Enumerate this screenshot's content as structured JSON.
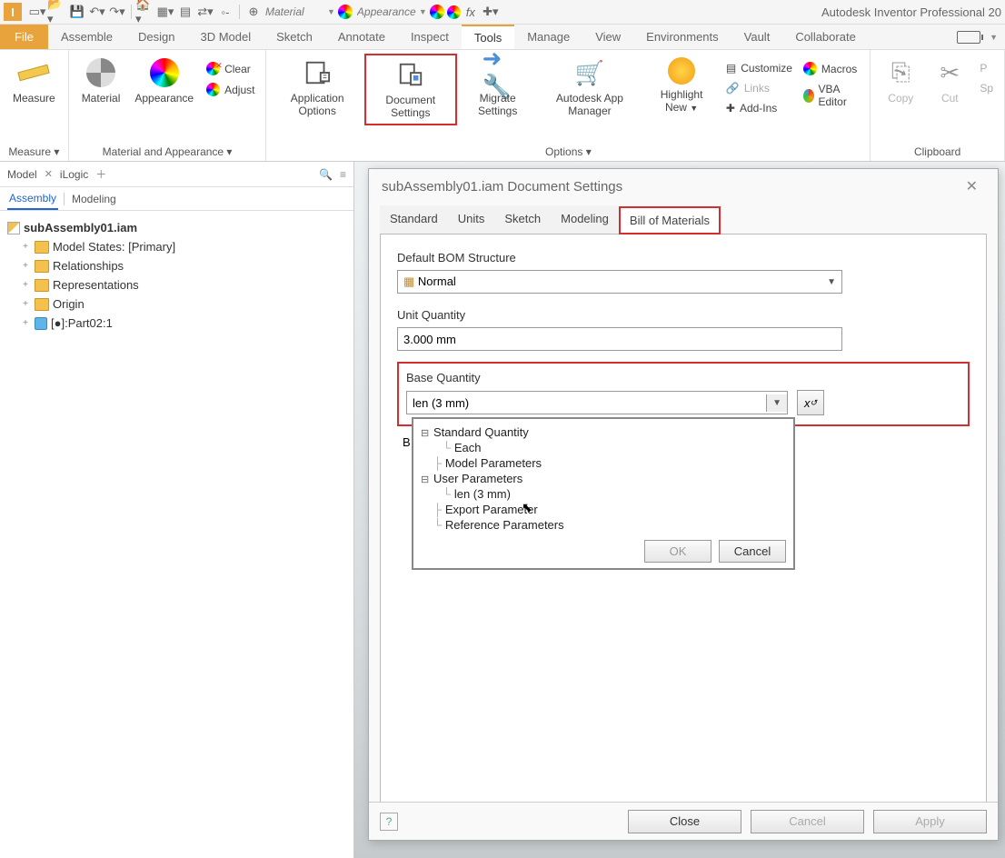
{
  "app_title": "Autodesk Inventor Professional 20",
  "material_placeholder": "Material",
  "appearance_placeholder": "Appearance",
  "menus": {
    "file": "File",
    "items": [
      "Assemble",
      "Design",
      "3D Model",
      "Sketch",
      "Annotate",
      "Inspect",
      "Tools",
      "Manage",
      "View",
      "Environments",
      "Vault",
      "Collaborate"
    ],
    "active": "Tools"
  },
  "ribbon": {
    "measure": {
      "label": "Measure",
      "group": "Measure ▾"
    },
    "material": {
      "label": "Material"
    },
    "appearance": {
      "label": "Appearance"
    },
    "clear": "Clear",
    "adjust": "Adjust",
    "matgroup": "Material and Appearance ▾",
    "appopts": "Application Options",
    "docsettings": "Document Settings",
    "migrate": "Migrate Settings",
    "appstore": "Autodesk App Manager",
    "highlight": "Highlight New",
    "customize": "Customize",
    "links": "Links",
    "addins": "Add-Ins",
    "macros": "Macros",
    "vba": "VBA Editor",
    "optgroup": "Options ▾",
    "copy": "Copy",
    "cut": "Cut",
    "paste": "P",
    "paste2": "Sp",
    "clipgroup": "Clipboard"
  },
  "panel": {
    "tab_model": "Model",
    "tab_ilogic": "iLogic",
    "sub_assembly": "Assembly",
    "sub_modeling": "Modeling",
    "root": "subAssembly01.iam",
    "nodes": {
      "model_states": "Model States: [Primary]",
      "relationships": "Relationships",
      "representations": "Representations",
      "origin": "Origin",
      "part": "[●]:Part02:1"
    }
  },
  "dialog": {
    "title": "subAssembly01.iam Document Settings",
    "tabs": [
      "Standard",
      "Units",
      "Sketch",
      "Modeling",
      "Bill of Materials"
    ],
    "active_tab": "Bill of Materials",
    "bom": {
      "default_bom_label": "Default BOM Structure",
      "default_bom_value": "Normal",
      "unit_qty_label": "Unit Quantity",
      "unit_qty_value": "3.000 mm",
      "base_qty_label": "Base Quantity",
      "base_qty_value": "len (3 mm)"
    },
    "dropdown": {
      "std": "Standard Quantity",
      "each": "Each",
      "model_params": "Model Parameters",
      "user_params": "User Parameters",
      "len": "len (3 mm)",
      "export_param": "Export Parameter",
      "ref_params": "Reference Parameters",
      "ok": "OK",
      "cancel": "Cancel"
    },
    "footer": {
      "close": "Close",
      "cancel": "Cancel",
      "apply": "Apply"
    }
  }
}
